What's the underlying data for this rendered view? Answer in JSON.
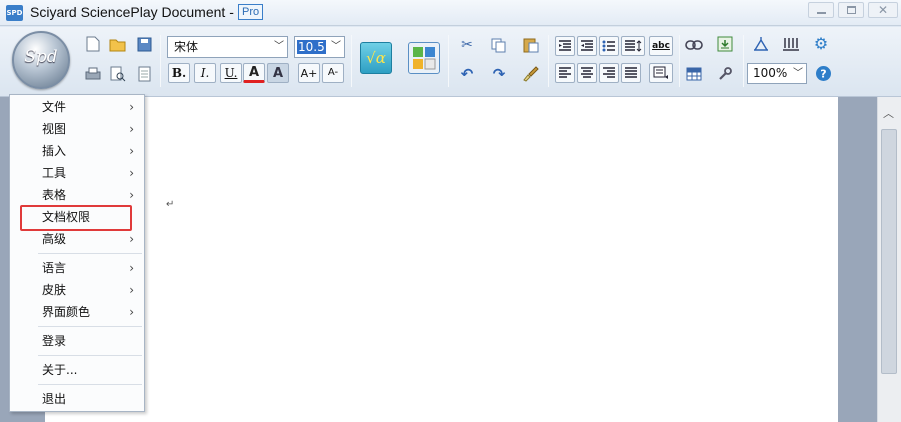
{
  "window": {
    "title": "Sciyard SciencePlay Document -",
    "badge": "Pro",
    "app_icon_text": "SPD"
  },
  "toolbar": {
    "orb_logo": "Spd",
    "font_name": "宋体",
    "font_size": "10.5",
    "zoom": "100%",
    "bold_label": "B.",
    "italic_label": "I.",
    "underline_label": "U.",
    "font_color_label": "A",
    "highlight_label": "A",
    "grow_font_label": "A+",
    "shrink_font_label": "A-",
    "formula_label": "√α",
    "spell_label": "abc"
  },
  "menu": {
    "items": [
      {
        "label": "文件",
        "submenu": true
      },
      {
        "label": "视图",
        "submenu": true
      },
      {
        "label": "插入",
        "submenu": true
      },
      {
        "label": "工具",
        "submenu": true
      },
      {
        "label": "表格",
        "submenu": true
      },
      {
        "label": "文档权限",
        "submenu": false
      },
      {
        "label": "高级",
        "submenu": true
      },
      {
        "label": "语言",
        "submenu": true
      },
      {
        "label": "皮肤",
        "submenu": true
      },
      {
        "label": "界面颜色",
        "submenu": true
      },
      {
        "label": "登录",
        "submenu": false
      },
      {
        "label": "关于...",
        "submenu": false
      },
      {
        "label": "退出",
        "submenu": false
      }
    ],
    "submenu_arrow": "›"
  },
  "document": {
    "paragraph_mark": "↵"
  },
  "colors": {
    "highlight": "#e03a3a",
    "accent": "#3a7ec9"
  }
}
